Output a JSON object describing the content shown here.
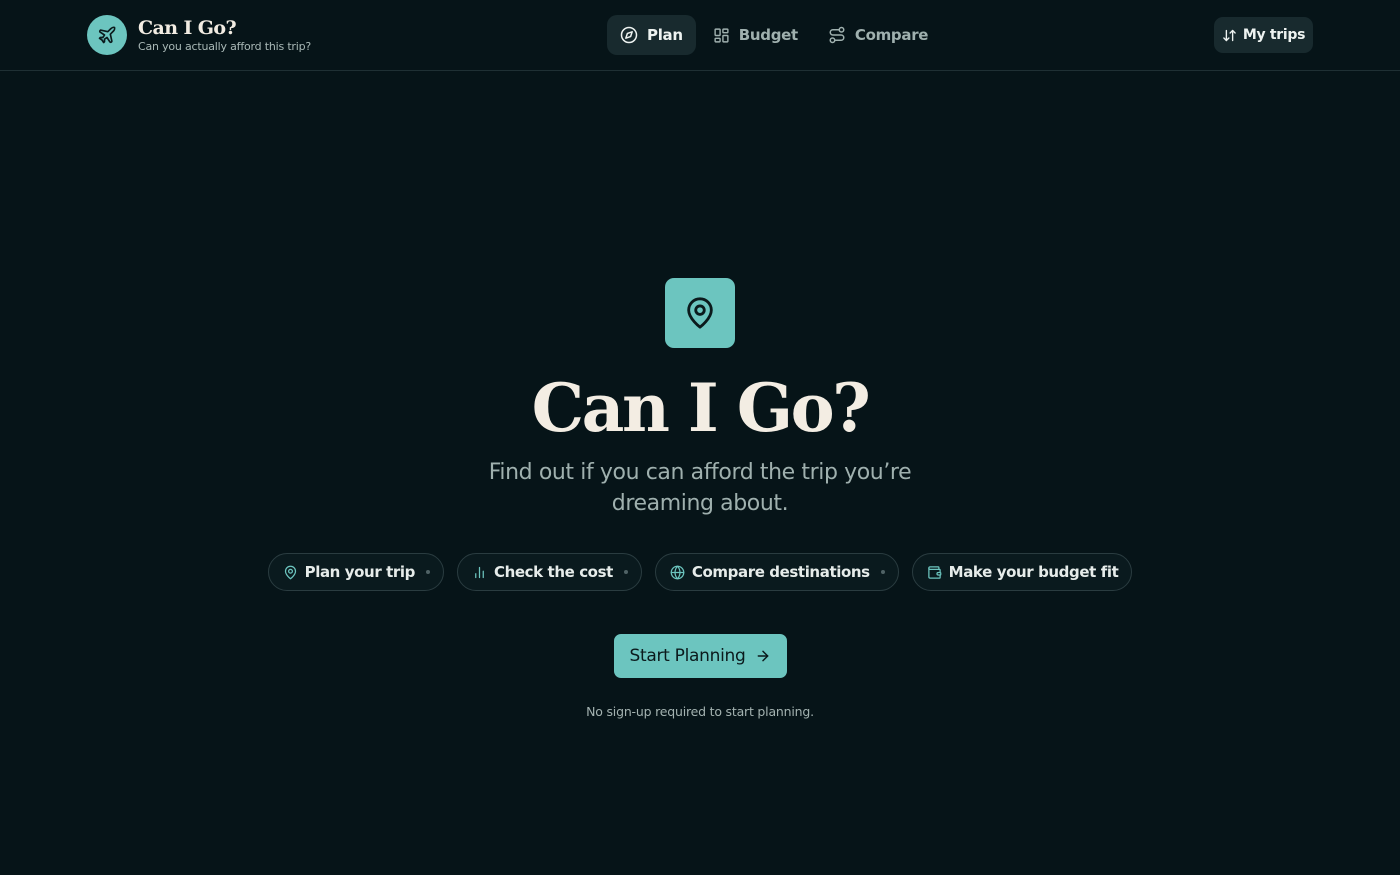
{
  "header": {
    "brand_title": "Can I Go?",
    "brand_subtitle": "Can you actually afford this trip?",
    "nav": [
      {
        "label": "Plan",
        "icon": "compass-icon",
        "active": true
      },
      {
        "label": "Budget",
        "icon": "grid-icon",
        "active": false
      },
      {
        "label": "Compare",
        "icon": "route-icon",
        "active": false
      }
    ],
    "my_trips_label": "My trips"
  },
  "hero": {
    "icon": "map-pin-icon",
    "title": "Can I Go?",
    "subtitle": "Find out if you can afford the trip you’re dreaming about.",
    "chips": [
      {
        "label": "Plan your trip",
        "icon": "map-pin-icon"
      },
      {
        "label": "Check the cost",
        "icon": "bar-chart-icon"
      },
      {
        "label": "Compare destinations",
        "icon": "globe-icon"
      },
      {
        "label": "Make your budget fit",
        "icon": "wallet-icon"
      }
    ],
    "cta_label": "Start Planning",
    "note": "No sign-up required to start planning."
  },
  "colors": {
    "background": "#061418",
    "accent": "#6cc5bf",
    "title": "#f3ede3",
    "muted": "#9fb0ae"
  }
}
